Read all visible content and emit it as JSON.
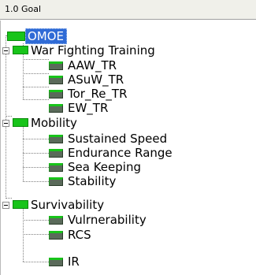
{
  "header": {
    "title": "1.0 Goal"
  },
  "root": {
    "label": "OMOE"
  },
  "groups": [
    {
      "label": "War Fighting Training",
      "children": [
        "AAW_TR",
        "ASuW_TR",
        "Tor_Re_TR",
        "EW_TR"
      ]
    },
    {
      "label": "Mobility",
      "children": [
        "Sustained Speed",
        "Endurance Range",
        "Sea Keeping",
        "Stability"
      ]
    },
    {
      "label": "Survivability",
      "children": [
        "Vulrnerability",
        "RCS",
        "IR"
      ]
    }
  ],
  "colors": {
    "node_green": "#18c41a",
    "node_gray": "#5a6a5a",
    "selection": "#2f6bd6"
  }
}
